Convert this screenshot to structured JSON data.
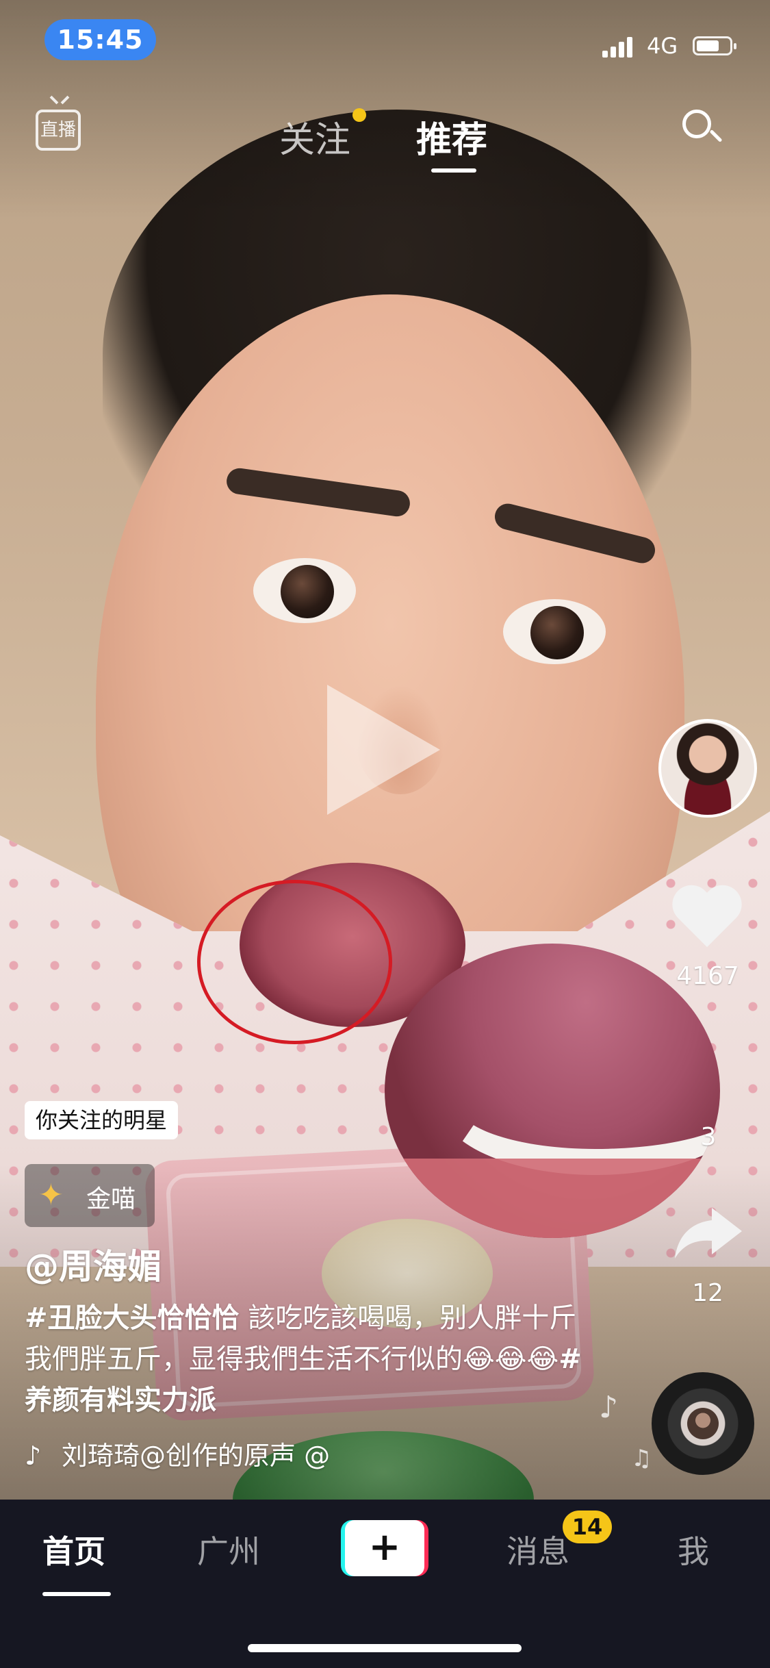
{
  "status_bar": {
    "time": "15:45",
    "network": "4G"
  },
  "top_nav": {
    "live_label": "直播",
    "tabs": [
      {
        "label": "关注",
        "has_dot": true
      },
      {
        "label": "推荐",
        "active": true
      }
    ],
    "search_icon": "search-icon"
  },
  "video": {
    "paused": true
  },
  "right_rail": {
    "like_count": "4167",
    "comment_count": "3",
    "share_count": "12"
  },
  "caption_area": {
    "follow_tag": "你关注的明星",
    "activity_label": "金喵",
    "author": "@周海媚",
    "caption_hashtag1": "#丑脸大头恰恰恰",
    "caption_text": " 該吃吃該喝喝，别人胖十斤我們胖五斤，显得我們生活不行似的😂😂😂",
    "caption_hashtag2": "#养颜有料实力派",
    "sound": "刘琦琦@创作的原声   @"
  },
  "tab_bar": {
    "home": "首页",
    "city": "广州",
    "create": "+",
    "messages": "消息",
    "messages_badge": "14",
    "me": "我"
  },
  "colors": {
    "time_pill": "#3a86f2",
    "badge": "#f5c518",
    "create_cyan": "#25f4ee",
    "create_red": "#fe2c55",
    "tab_bar_bg": "#161722",
    "annotation_circle": "#d51b24"
  }
}
